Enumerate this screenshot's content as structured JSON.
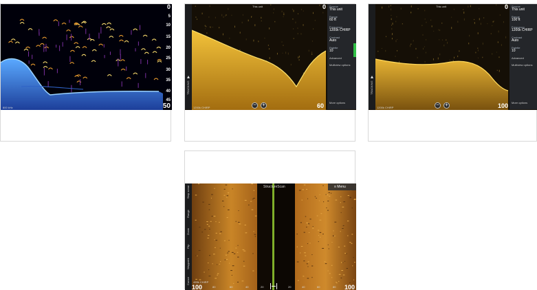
{
  "shots": {
    "s1": {
      "scale": [
        "0",
        "5",
        "10",
        "15",
        "20",
        "25",
        "30",
        "35",
        "40",
        "45"
      ],
      "range_label": "50",
      "freq_corner": "800 kHz"
    },
    "s2": {
      "title": "This unit",
      "top_depth": "0",
      "range_label": "60",
      "freq_corner": "1200k CHIRP",
      "side_tab": "TRACKING",
      "zoom_out": "−",
      "zoom_in": "+",
      "menu": {
        "source_label": "Source",
        "source_value": "This unit",
        "range_label": "Range",
        "range_value": "60 ft",
        "frequency_label": "Frequency",
        "frequency_value": "1200k CHIRP",
        "contrast_label": "Contrast",
        "contrast_value": "Auto",
        "palette_label": "Palette",
        "palette_value": "10",
        "advanced": "Advanced",
        "multiview": "Multiview options",
        "more": "More options"
      }
    },
    "s3": {
      "title": "This unit",
      "top_depth": "0",
      "range_label": "100",
      "freq_corner": "1200k CHIRP",
      "side_tab": "TRACKING",
      "zoom_out": "−",
      "zoom_in": "+",
      "menu": {
        "source_label": "Source",
        "source_value": "This unit",
        "range_label": "Range",
        "range_value": "100 ft",
        "frequency_label": "Frequency",
        "frequency_value": "1200k CHIRP",
        "contrast_label": "Contrast",
        "contrast_value": "Auto",
        "palette_label": "Palette",
        "palette_value": "10",
        "advanced": "Advanced",
        "multiview": "Multiview options",
        "more": "More options"
      }
    },
    "s4": {
      "title": "StructureScan",
      "menu_button": "≡ Menu",
      "left_range": "100",
      "right_range": "100",
      "freq_corner": "455k CHIRP",
      "tick_labels": [
        "80",
        "60",
        "40",
        "20",
        "20",
        "40",
        "60",
        "80"
      ],
      "side_tabs": [
        "Stop sonar",
        "Range",
        "Zoom",
        "Flip",
        "Waypoint",
        "Cursor"
      ]
    }
  }
}
